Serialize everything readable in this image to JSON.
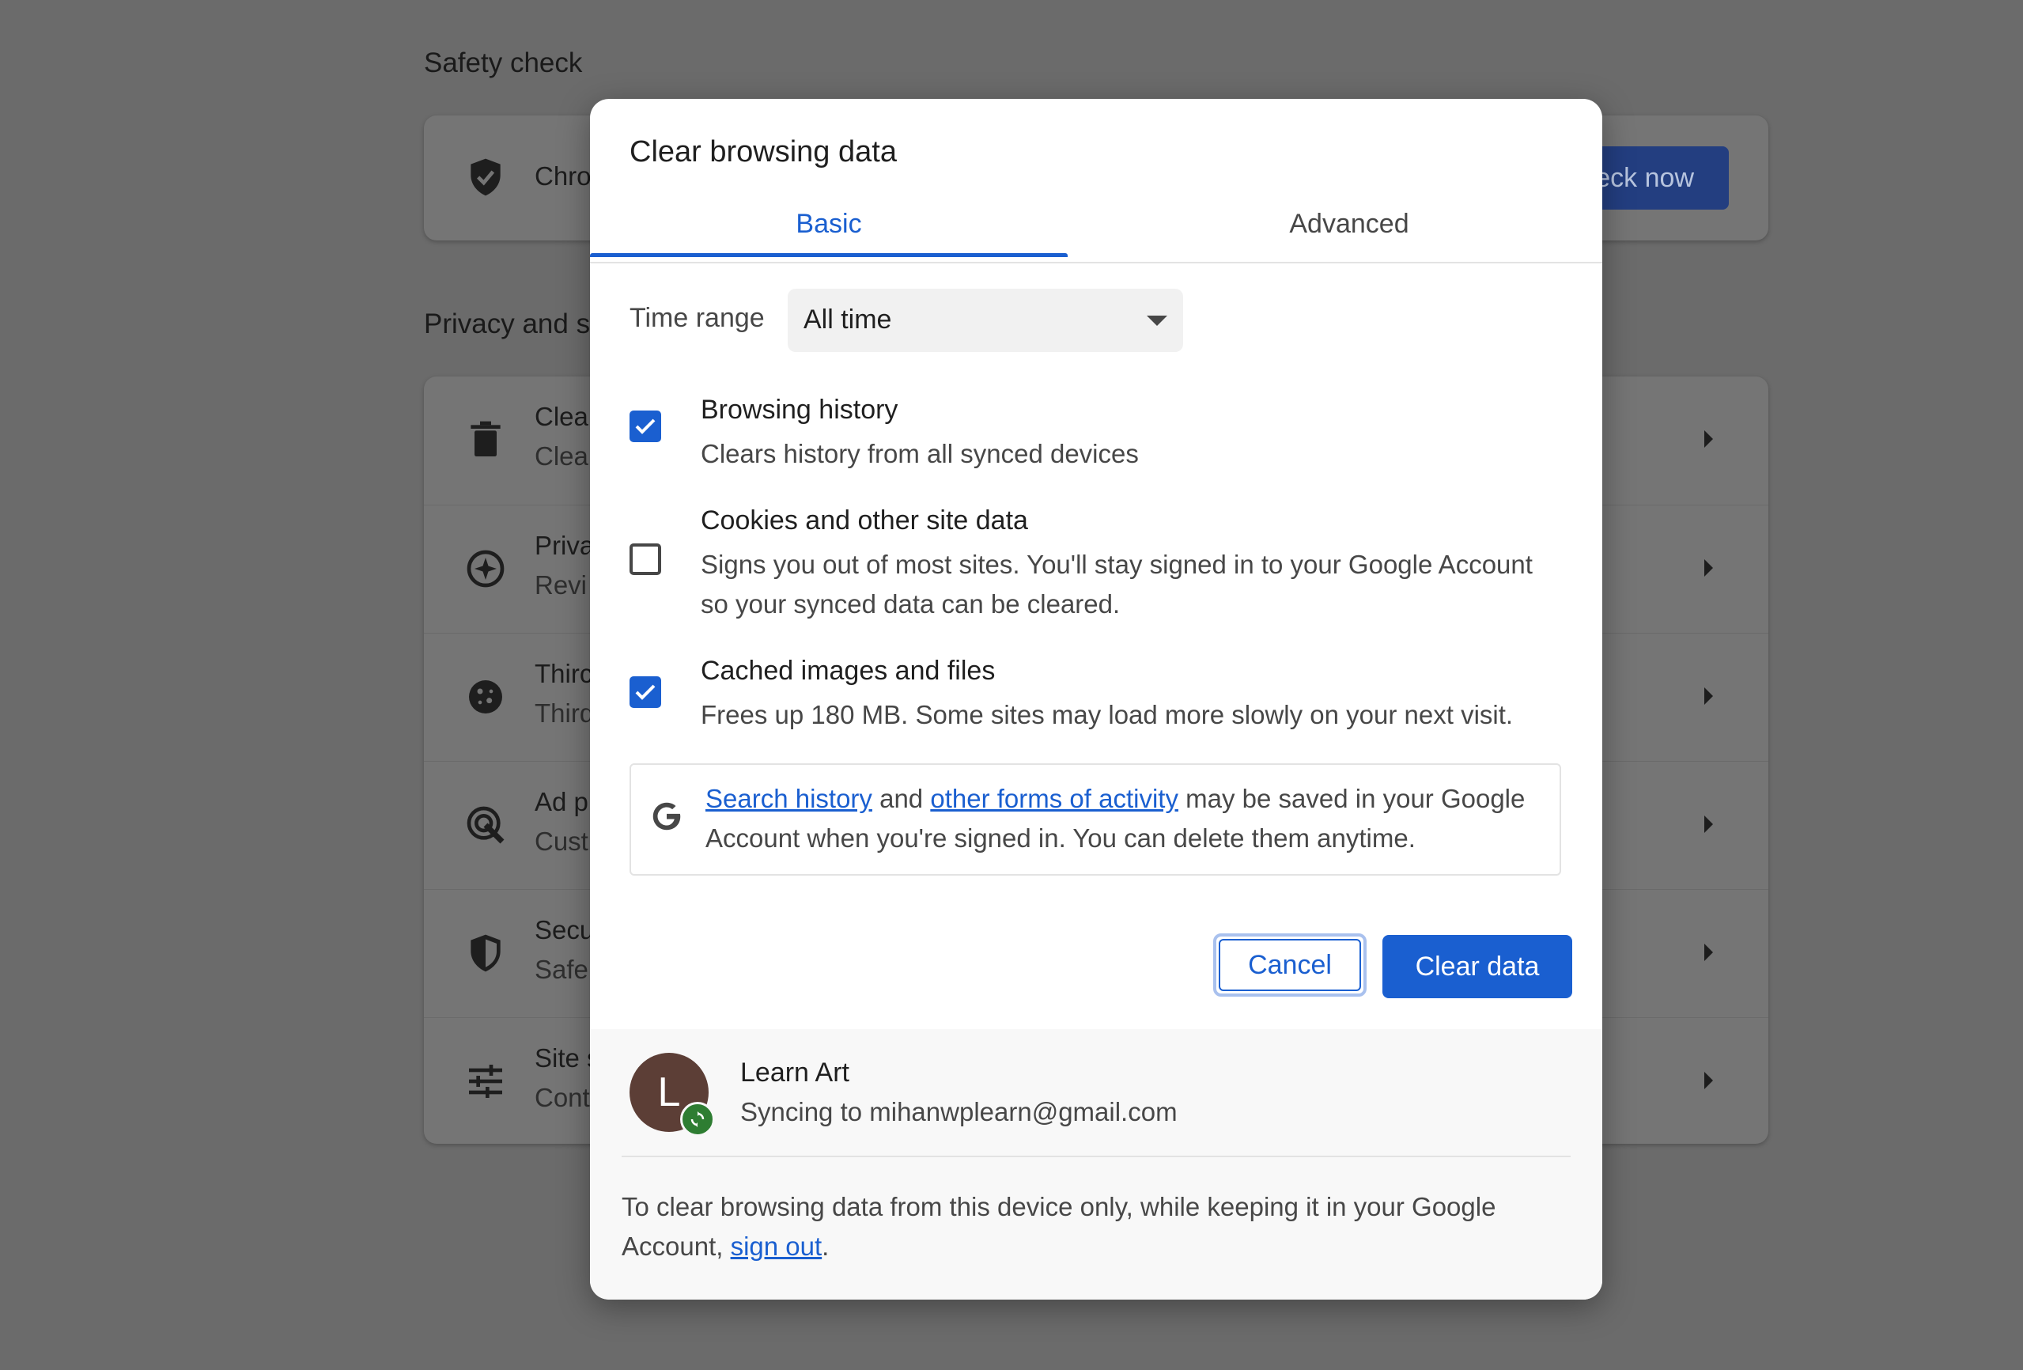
{
  "background": {
    "safety_check": {
      "section_title": "Safety check",
      "row_title": "Chro",
      "check_now_label": "eck now"
    },
    "privacy": {
      "section_title": "Privacy and s",
      "rows": [
        {
          "title": "Clea",
          "subtitle": "Clea",
          "icon": "trash-icon"
        },
        {
          "title": "Priva",
          "subtitle": "Revi",
          "icon": "compass-icon"
        },
        {
          "title": "Thirc",
          "subtitle": "Third",
          "icon": "cookie-icon"
        },
        {
          "title": "Ad p",
          "subtitle": "Cust",
          "icon": "ad-privacy-icon"
        },
        {
          "title": "Secu",
          "subtitle": "Safe",
          "icon": "security-shield-icon"
        },
        {
          "title": "Site s",
          "subtitle": "Cont",
          "icon": "sliders-icon"
        }
      ]
    }
  },
  "dialog": {
    "title": "Clear browsing data",
    "tabs": [
      {
        "label": "Basic",
        "selected": true
      },
      {
        "label": "Advanced",
        "selected": false
      }
    ],
    "time_range": {
      "label": "Time range",
      "value": "All time"
    },
    "options": [
      {
        "title": "Browsing history",
        "description": "Clears history from all synced devices",
        "checked": true
      },
      {
        "title": "Cookies and other site data",
        "description": "Signs you out of most sites. You'll stay signed in to your Google Account so your synced data can be cleared.",
        "checked": false
      },
      {
        "title": "Cached images and files",
        "description": "Frees up 180 MB. Some sites may load more slowly on your next visit.",
        "checked": true
      }
    ],
    "google_notice": {
      "link1": "Search history",
      "and": " and ",
      "link2": "other forms of activity",
      "rest": " may be saved in your Google Account when you're signed in. You can delete them anytime."
    },
    "buttons": {
      "cancel": "Cancel",
      "clear": "Clear data"
    },
    "account": {
      "initial": "L",
      "name": "Learn Art",
      "sync_status": "Syncing to mihanwplearn@gmail.com"
    },
    "footer_note": {
      "text": "To clear browsing data from this device only, while keeping it in your Google Account, ",
      "link": "sign out",
      "end": "."
    },
    "colors": {
      "accent": "#1a5fd0",
      "overlay": "#6b6b6b",
      "sync_badge": "#2e7d32",
      "avatar": "#5c3e36"
    }
  }
}
